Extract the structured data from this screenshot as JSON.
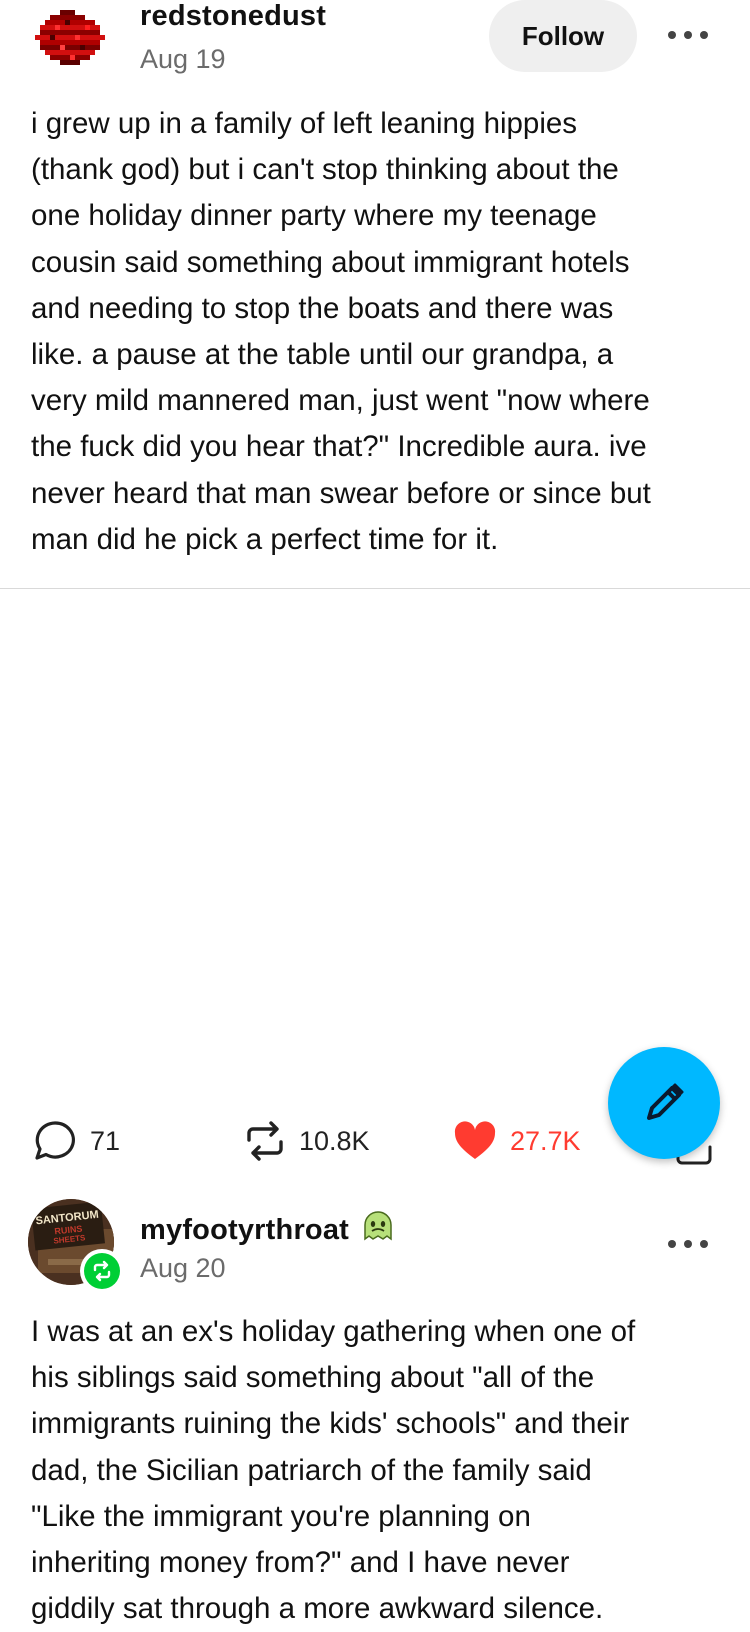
{
  "post1": {
    "username": "redstonedust",
    "date": "Aug 19",
    "follow_label": "Follow",
    "body": "i grew up in a family of left leaning hippies\n(thank god) but i can't stop thinking about the\none holiday dinner party where my teenage\ncousin said something about immigrant hotels\nand needing to stop the boats and there was\nlike. a pause at the table until our grandpa, a\nvery mild mannered man, just went \"now where\nthe fuck did you hear that?\" Incredible aura. ive\nnever heard that man swear before or since but\nman did he pick a perfect time for it."
  },
  "post2": {
    "username": "myfootyrthroat",
    "date": "Aug 20",
    "avatar_text": [
      "SANTORUM",
      "RUINS",
      "SHEETS"
    ],
    "body": "I was at an ex's holiday gathering when one of\nhis siblings said something about \"all of the\nimmigrants ruining the kids' schools\" and their\ndad, the Sicilian patriarch of the family said\n\"Like the immigrant you're planning on\ninheriting money from?\" and I have never\ngiddily sat through a more awkward silence."
  },
  "footer": {
    "replies": "71",
    "reblogs": "10.8K",
    "likes": "27.7K"
  },
  "colors": {
    "accent_blue": "#00b8ff",
    "reblog_green": "#00cf35",
    "like_red": "#ff3b30",
    "avatar_red": "#d10f0f"
  },
  "icons": {
    "reply": "speech-bubble-icon",
    "reblog": "reblog-arrows-icon",
    "like": "heart-icon",
    "compose": "pencil-icon"
  }
}
